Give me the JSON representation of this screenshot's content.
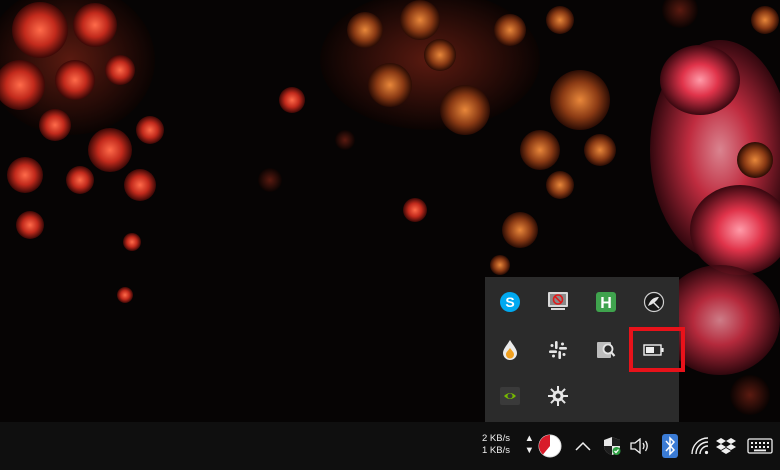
{
  "taskbar": {
    "network_speed": {
      "upload": "2 KB/s",
      "download": "1 KB/s",
      "upload_arrow": "▲",
      "download_arrow": "▼"
    }
  },
  "tray_overflow": {
    "icons": [
      {
        "name": "skype-icon"
      },
      {
        "name": "no-signal-monitor-icon"
      },
      {
        "name": "h-app-icon"
      },
      {
        "name": "satellite-dish-icon"
      },
      {
        "name": "drop-app-icon"
      },
      {
        "name": "slack-icon"
      },
      {
        "name": "magnifier-app-icon"
      },
      {
        "name": "battery-icon",
        "highlighted": true
      },
      {
        "name": "nvidia-icon"
      },
      {
        "name": "gear-app-icon"
      }
    ]
  },
  "colors": {
    "highlight": "#e8121a",
    "flyout_bg": "#2b2b2b",
    "taskbar_bg": "#0f0f0f",
    "skype_blue": "#00a9f0",
    "h_green": "#3fa34d",
    "bluetooth_blue": "#3a7bd5"
  }
}
